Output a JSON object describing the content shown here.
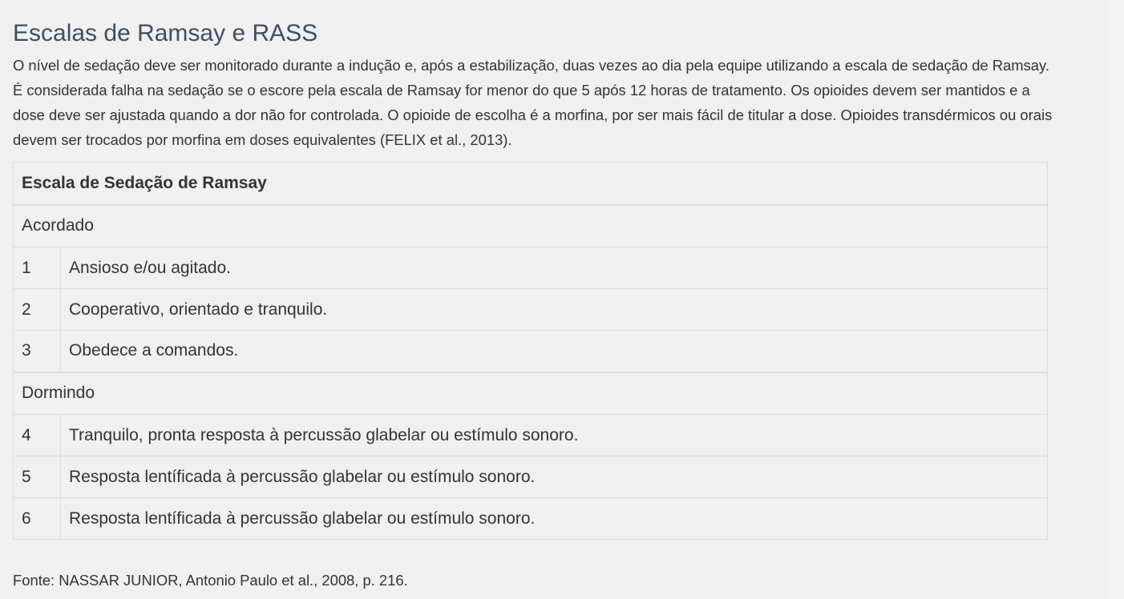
{
  "title": "Escalas de Ramsay e RASS",
  "intro": "O nível de sedação deve ser monitorado durante a indução e, após a estabilização, duas vezes ao dia pela equipe utilizando a escala de sedação de Ramsay. É considerada falha na sedação se o escore pela escala de Ramsay for menor do que 5 após 12 horas de tratamento. Os opioides devem ser mantidos e a dose deve ser ajustada quando a dor não for controlada. O opioide de escolha é a morfina, por ser mais fácil de titular a dose. Opioides transdérmicos ou orais devem ser trocados por morfina em doses equivalentes (FELIX et al., 2013).",
  "table": {
    "header": "Escala de Sedação de Ramsay",
    "groups": [
      {
        "label": "Acordado",
        "rows": [
          {
            "score": "1",
            "description": "Ansioso e/ou agitado."
          },
          {
            "score": "2",
            "description": "Cooperativo, orientado e tranquilo."
          },
          {
            "score": "3",
            "description": "Obedece a comandos."
          }
        ]
      },
      {
        "label": "Dormindo",
        "rows": [
          {
            "score": "4",
            "description": "Tranquilo, pronta resposta à percussão glabelar ou estímulo sonoro."
          },
          {
            "score": "5",
            "description": "Resposta lentíficada à percussão glabelar ou estímulo sonoro."
          },
          {
            "score": "6",
            "description": "Resposta lentíficada à percussão glabelar ou estímulo sonoro."
          }
        ]
      }
    ]
  },
  "source": "Fonte: NASSAR JUNIOR, Antonio Paulo et al., 2008, p. 216."
}
